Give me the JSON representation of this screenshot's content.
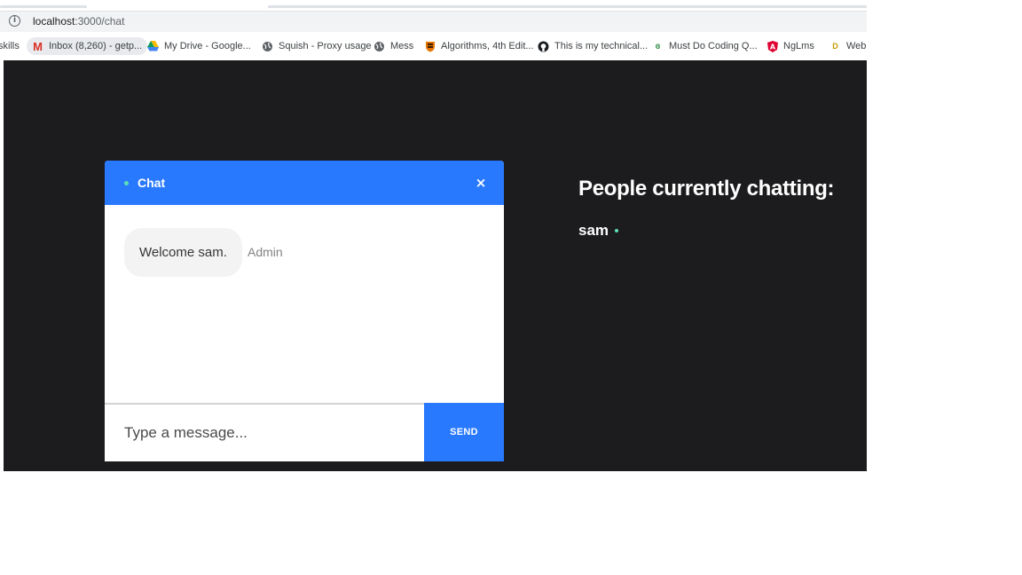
{
  "browser": {
    "url_host": "localhost",
    "url_path": ":3000/chat",
    "bookmarks": [
      {
        "label": "skills",
        "icon": "none"
      },
      {
        "label": "Inbox (8,260) - getp...",
        "icon": "gmail-icon"
      },
      {
        "label": "My Drive - Google...",
        "icon": "google-drive-icon"
      },
      {
        "label": "Squish - Proxy usage",
        "icon": "globe-icon"
      },
      {
        "label": "Mess",
        "icon": "globe-icon"
      },
      {
        "label": "Algorithms, 4th Edit...",
        "icon": "princeton-shield-icon"
      },
      {
        "label": "This is my technical...",
        "icon": "github-icon"
      },
      {
        "label": "Must Do Coding Q...",
        "icon": "geeksforgeeks-icon"
      },
      {
        "label": "NgLms",
        "icon": "angular-icon"
      },
      {
        "label": "Web D",
        "icon": "bookmark-icon"
      }
    ]
  },
  "chat": {
    "title": "Chat",
    "close_label": "×",
    "messages": [
      {
        "text": "Welcome sam.",
        "sender": "Admin"
      }
    ],
    "input_placeholder": "Type a message...",
    "send_label": "SEND"
  },
  "people": {
    "title": "People currently chatting:",
    "users": [
      "sam"
    ]
  },
  "colors": {
    "header_blue": "#2979ff",
    "online_green": "#5de0b6",
    "page_bg": "#1c1c1e"
  }
}
